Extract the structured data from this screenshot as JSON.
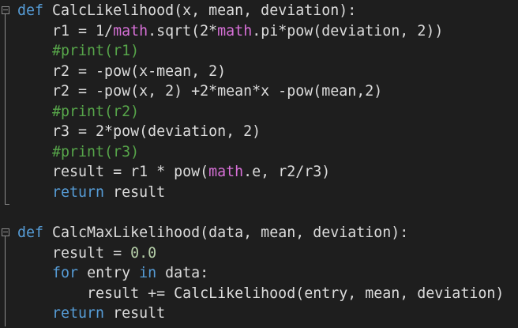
{
  "code": {
    "func1": {
      "def_kw": "def",
      "signature": " CalcLikelihood(x, mean, deviation):",
      "l1_a": "    r1 = 1/",
      "l1_mod1": "math",
      "l1_b": ".sqrt(2*",
      "l1_mod2": "math",
      "l1_c": ".pi*pow(deviation, 2))",
      "l2": "    #print(r1)",
      "l3": "    r2 = -pow(x-mean, 2)",
      "l4": "    r2 = -pow(x, 2) +2*mean*x -pow(mean,2)",
      "l5": "    #print(r2)",
      "l6": "    r3 = 2*pow(deviation, 2)",
      "l7": "    #print(r3)",
      "l8_a": "    result = r1 * pow(",
      "l8_mod": "math",
      "l8_b": ".e, r2/r3)",
      "l9_indent": "    ",
      "l9_kw": "return",
      "l9_b": " result"
    },
    "func2": {
      "def_kw": "def",
      "signature": " CalcMaxLikelihood(data, mean, deviation):",
      "l1_a": "    result = ",
      "l1_num": "0.0",
      "l2_indent": "    ",
      "l2_for": "for",
      "l2_b": " entry ",
      "l2_in": "in",
      "l2_c": " data:",
      "l3": "        result += CalcLikelihood(entry, mean, deviation)",
      "l4_indent": "    ",
      "l4_kw": "return",
      "l4_b": " result"
    }
  },
  "colors": {
    "background": "#1e1e1e",
    "keyword": "#569cd6",
    "module": "#d670d6",
    "comment": "#57a64a",
    "number": "#b5cea8",
    "text": "#dcdcdc"
  }
}
